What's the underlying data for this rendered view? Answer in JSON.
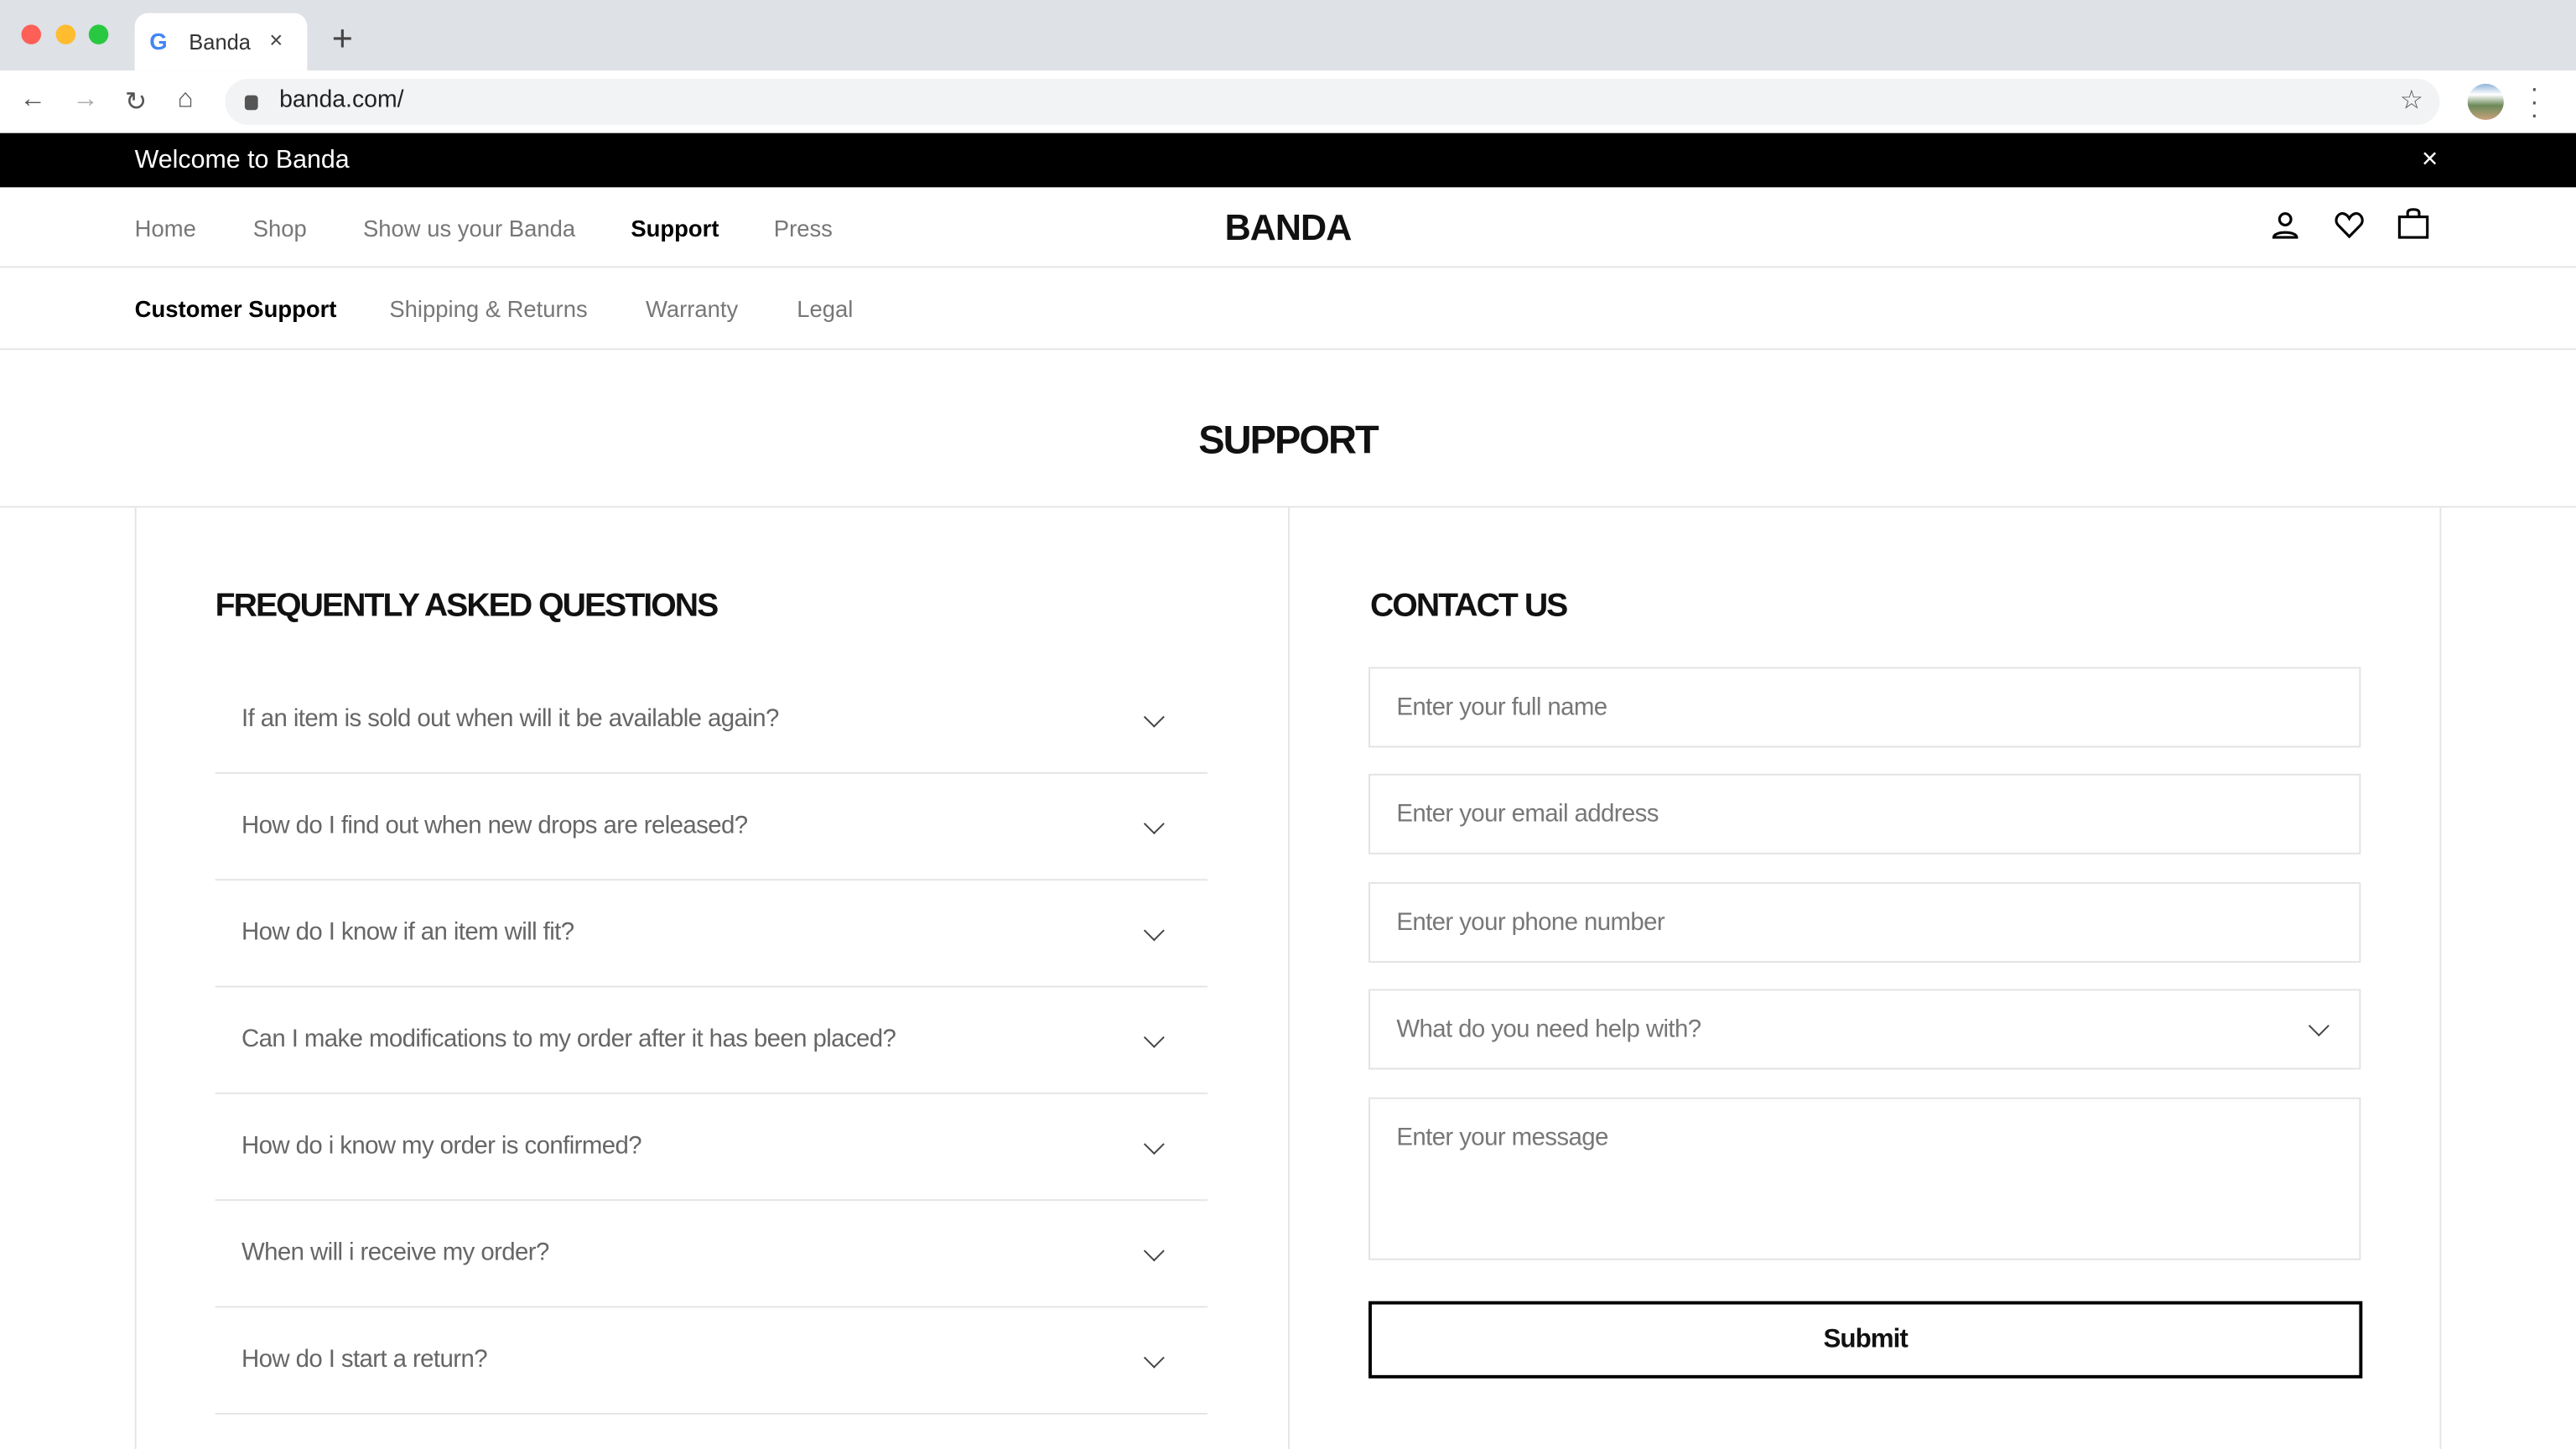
{
  "browser": {
    "tab_title": "Banda",
    "url": "banda.com/",
    "tab_close": "×",
    "new_tab": "+"
  },
  "banner": {
    "message": "Welcome to Banda",
    "close": "×"
  },
  "nav": {
    "items": [
      "Home",
      "Shop",
      "Show us your Banda",
      "Support",
      "Press"
    ],
    "active": "Support",
    "logo": "BANDA"
  },
  "subnav": {
    "items": [
      "Customer Support",
      "Shipping & Returns",
      "Warranty",
      "Legal"
    ],
    "active": "Customer Support"
  },
  "page": {
    "title": "SUPPORT"
  },
  "faq": {
    "heading": "FREQUENTLY ASKED QUESTIONS",
    "questions": [
      "If an item is sold out when will it be available again?",
      "How do I find out when new drops are released?",
      "How do I know if an item will fit?",
      "Can I make modifications  to my order after it has been placed?",
      "How do i know my order is confirmed?",
      "When will i receive my order?",
      "How do I start a return?"
    ]
  },
  "contact": {
    "heading": "CONTACT US",
    "name_placeholder": "Enter your full name",
    "email_placeholder": "Enter your email address",
    "phone_placeholder": "Enter your phone number",
    "topic_placeholder": "What do you need help with?",
    "message_placeholder": "Enter your message",
    "submit_label": "Submit"
  }
}
